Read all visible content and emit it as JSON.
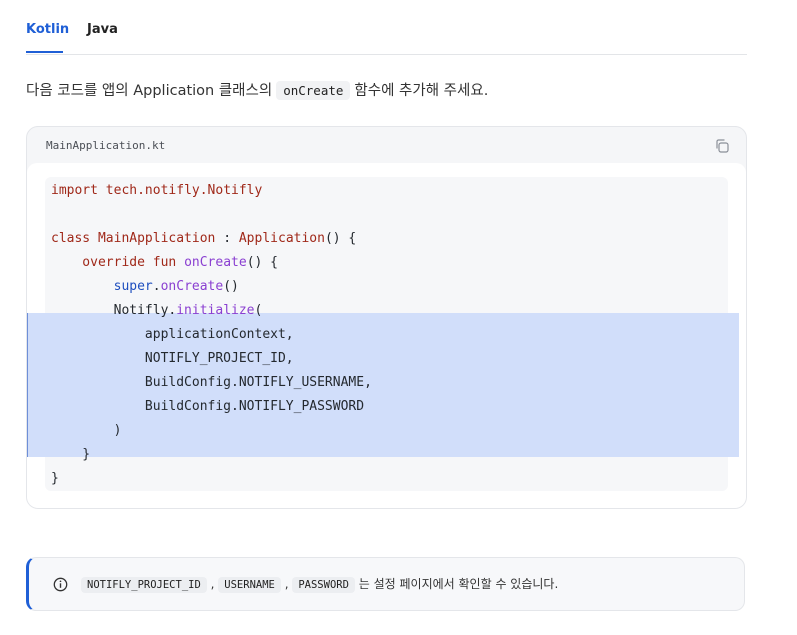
{
  "tabs": [
    {
      "label": "Kotlin",
      "active": true
    },
    {
      "label": "Java",
      "active": false
    }
  ],
  "intro": {
    "before": "다음 코드를 앱의 Application 클래스의",
    "code": "onCreate",
    "after": "함수에 추가해 주세요."
  },
  "code_block": {
    "filename": "MainApplication.kt",
    "copy_icon": "copy-icon",
    "lines": [
      {
        "segments": [
          {
            "t": "import ",
            "c": "kw"
          },
          {
            "t": "tech.notifly.Notifly",
            "c": "ty"
          }
        ]
      },
      {
        "segments": []
      },
      {
        "segments": [
          {
            "t": "class ",
            "c": "kw"
          },
          {
            "t": "MainApplication",
            "c": "ty"
          },
          {
            "t": " : ",
            "c": ""
          },
          {
            "t": "Application",
            "c": "ty"
          },
          {
            "t": "() {",
            "c": ""
          }
        ]
      },
      {
        "segments": [
          {
            "t": "    override fun ",
            "c": "kw"
          },
          {
            "t": "onCreate",
            "c": "fn"
          },
          {
            "t": "() {",
            "c": ""
          }
        ]
      },
      {
        "segments": [
          {
            "t": "        ",
            "c": ""
          },
          {
            "t": "super",
            "c": "bl"
          },
          {
            "t": ".",
            "c": ""
          },
          {
            "t": "onCreate",
            "c": "fn"
          },
          {
            "t": "()",
            "c": ""
          }
        ]
      },
      {
        "segments": [
          {
            "t": "        Notifly.",
            "c": ""
          },
          {
            "t": "initialize",
            "c": "fn"
          },
          {
            "t": "(",
            "c": ""
          }
        ]
      },
      {
        "segments": [
          {
            "t": "            applicationContext,",
            "c": ""
          }
        ]
      },
      {
        "segments": [
          {
            "t": "            NOTIFLY_PROJECT_ID,",
            "c": ""
          }
        ]
      },
      {
        "segments": [
          {
            "t": "            BuildConfig.NOTIFLY_USERNAME,",
            "c": ""
          }
        ]
      },
      {
        "segments": [
          {
            "t": "            BuildConfig.NOTIFLY_PASSWORD",
            "c": ""
          }
        ]
      },
      {
        "segments": [
          {
            "t": "        )",
            "c": ""
          }
        ]
      },
      {
        "segments": [
          {
            "t": "    }",
            "c": ""
          }
        ]
      },
      {
        "segments": [
          {
            "t": "}",
            "c": ""
          }
        ]
      }
    ],
    "highlighted_lines": [
      6,
      11
    ]
  },
  "info": {
    "icon": "info-icon",
    "code1": "NOTIFLY_PROJECT_ID",
    "sep1": ",",
    "code2": "USERNAME",
    "sep2": ",",
    "code3": "PASSWORD",
    "text": "는 설정 페이지에서 확인할 수 있습니다."
  },
  "colors": {
    "accent": "#1f5fd6",
    "highlight": "#d1defa",
    "keyword": "#a0291a",
    "function": "#8a3fd1"
  }
}
